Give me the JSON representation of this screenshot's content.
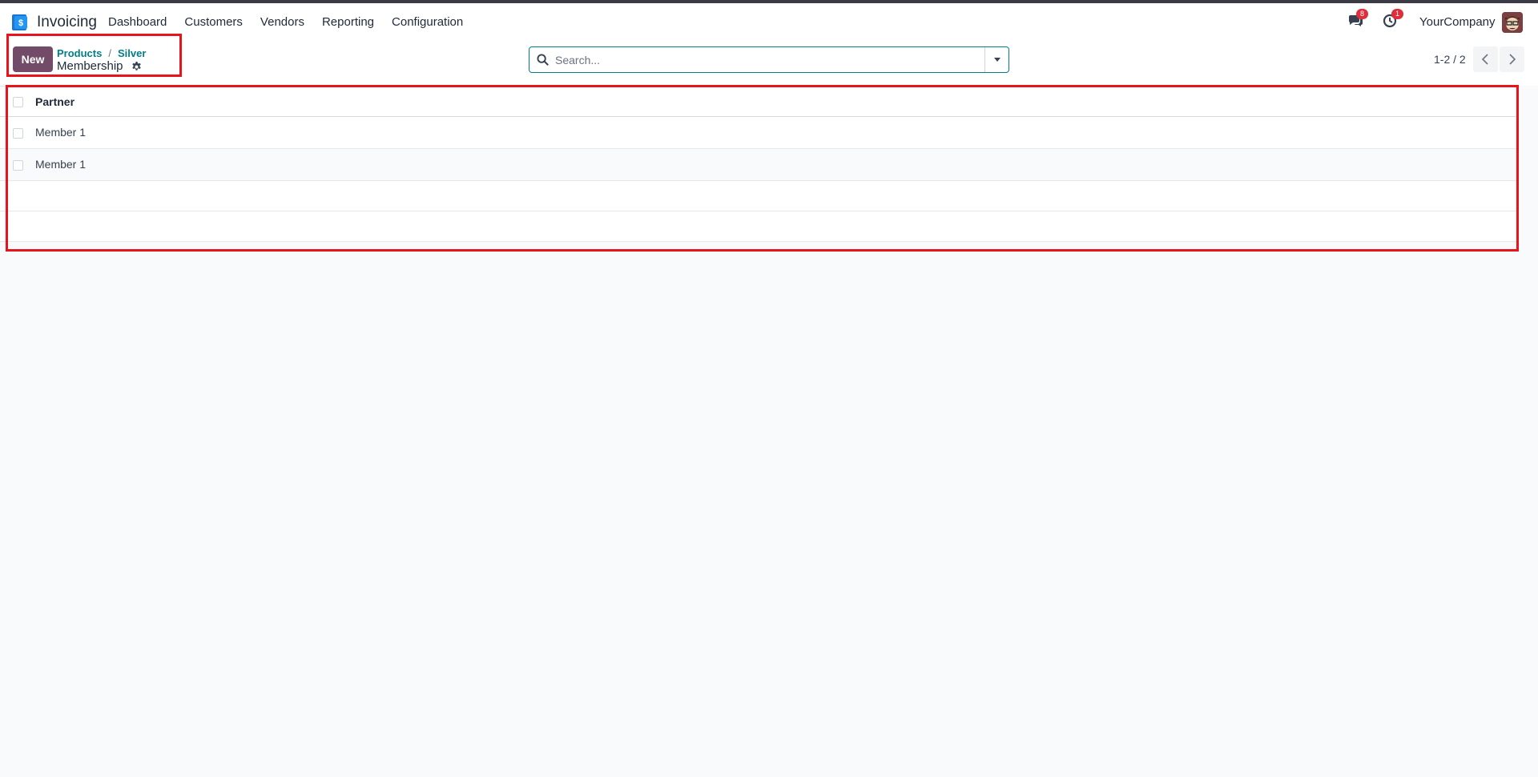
{
  "navbar": {
    "app_name": "Invoicing",
    "menu": [
      "Dashboard",
      "Customers",
      "Vendors",
      "Reporting",
      "Configuration"
    ],
    "messages_badge": "8",
    "activities_badge": "1",
    "company": "YourCompany"
  },
  "control_panel": {
    "new_label": "New",
    "breadcrumb": [
      "Products",
      "Silver"
    ],
    "breadcrumb_sep": "/",
    "title": "Membership",
    "search_placeholder": "Search...",
    "pager": "1-2 / 2"
  },
  "list": {
    "columns": [
      "Partner"
    ],
    "rows": [
      {
        "partner": "Member 1"
      },
      {
        "partner": "Member 1"
      }
    ]
  },
  "colors": {
    "primary": "#714b67",
    "link": "#017e84",
    "highlight": "#e8131c"
  },
  "icons": [
    "app-logo-icon",
    "chat-icon",
    "clock-icon",
    "gear-icon",
    "search-icon",
    "caret-down-icon",
    "chevron-left-icon",
    "chevron-right-icon"
  ]
}
